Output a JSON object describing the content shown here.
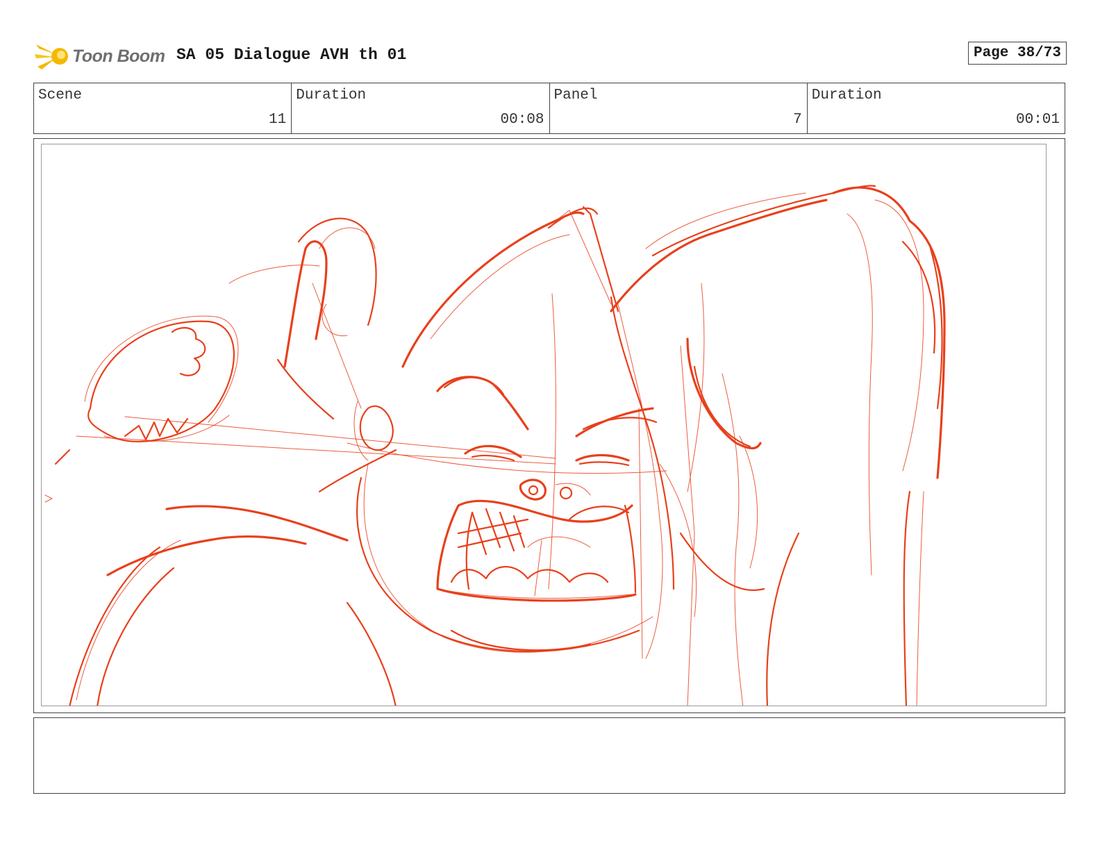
{
  "header": {
    "logo_text": "Toon Boom",
    "title": "SA 05 Dialogue AVH th 01",
    "page": "Page 38/73"
  },
  "info": [
    {
      "label": "Scene",
      "value": "11"
    },
    {
      "label": "Duration",
      "value": "00:08"
    },
    {
      "label": "Panel",
      "value": "7"
    },
    {
      "label": "Duration",
      "value": "00:01"
    }
  ],
  "colors": {
    "sketch_line": "#e8401c",
    "logo_flame": "#f5b800",
    "border": "#444444"
  },
  "icons": {
    "logo": "toon-boom-comet-icon"
  },
  "notes": ""
}
